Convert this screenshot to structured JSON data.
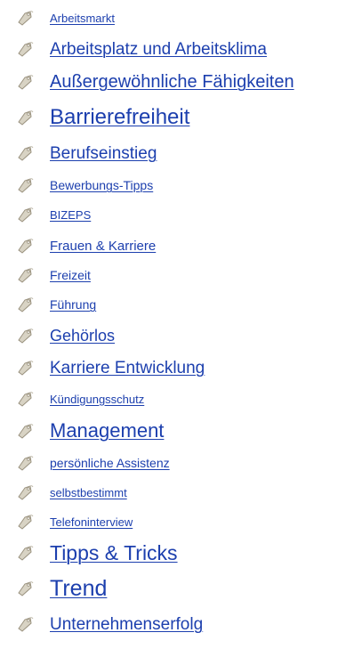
{
  "tags": [
    {
      "label": "Arbeitsmarkt"
    },
    {
      "label": "Arbeitsplatz und Arbeitsklima"
    },
    {
      "label": "Außergewöhnliche Fähigkeiten"
    },
    {
      "label": "Barrierefreiheit"
    },
    {
      "label": "Berufseinstieg"
    },
    {
      "label": "Bewerbungs-Tipps"
    },
    {
      "label": "BIZEPS"
    },
    {
      "label": "Frauen & Karriere"
    },
    {
      "label": "Freizeit"
    },
    {
      "label": "Führung"
    },
    {
      "label": "Gehörlos"
    },
    {
      "label": "Karriere Entwicklung"
    },
    {
      "label": "Kündigungsschutz"
    },
    {
      "label": "Management"
    },
    {
      "label": "persönliche Assistenz"
    },
    {
      "label": "selbstbestimmt"
    },
    {
      "label": "Telefoninterview"
    },
    {
      "label": "Tipps & Tricks"
    },
    {
      "label": "Trend"
    },
    {
      "label": "Unternehmenserfolg"
    }
  ],
  "icon": "tag-icon",
  "colors": {
    "link": "#1c3fae",
    "icon_fill": "#d8d3c4",
    "icon_stroke": "#9a927f"
  }
}
